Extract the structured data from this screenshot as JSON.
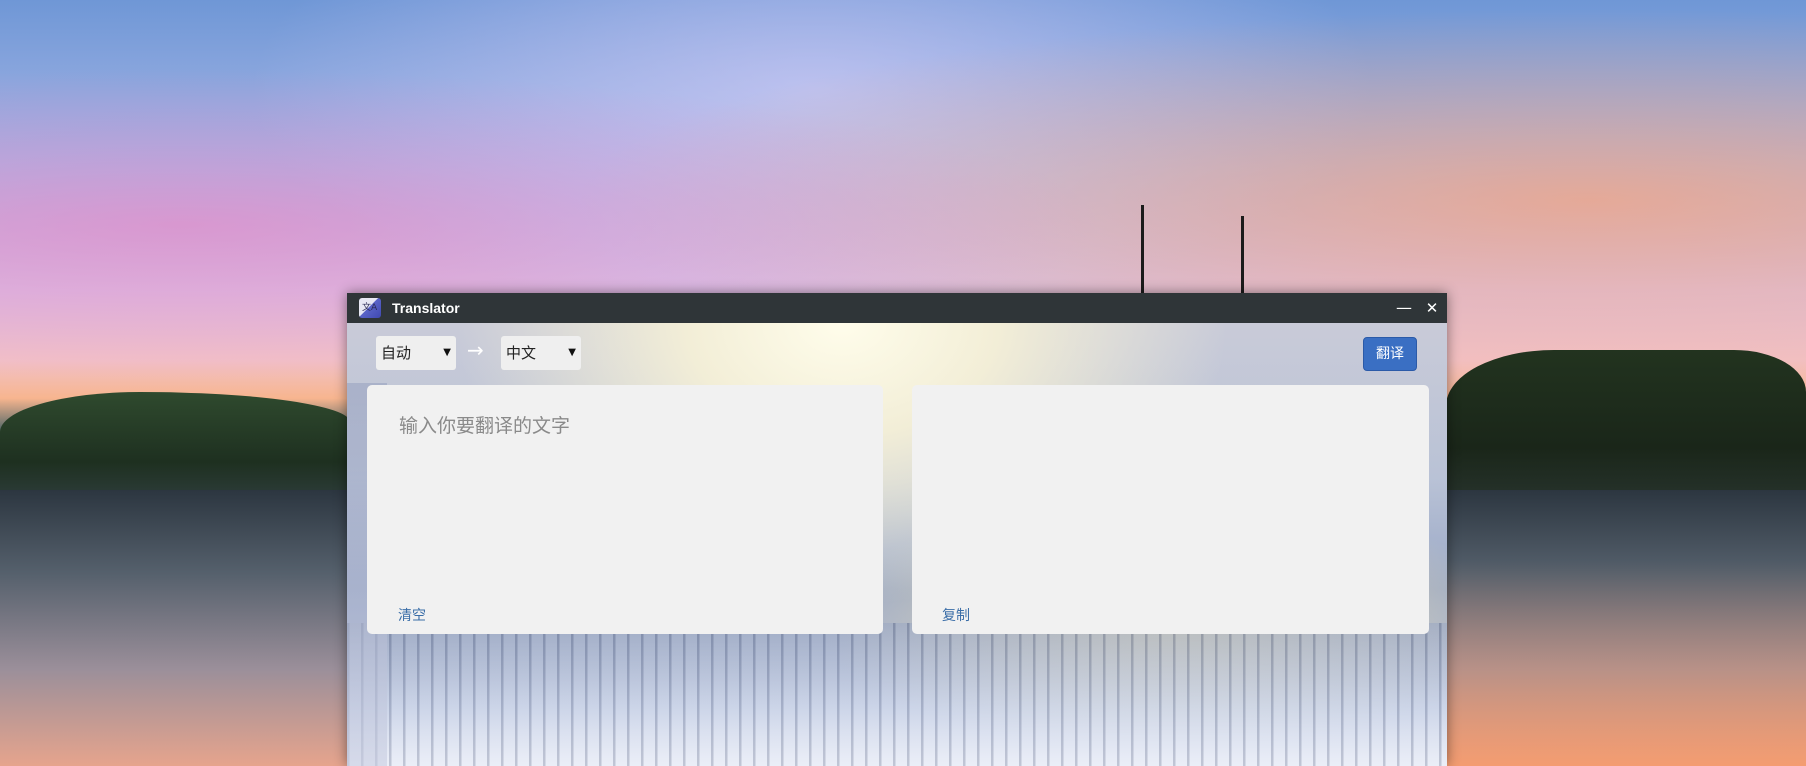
{
  "window": {
    "title": "Translator",
    "app_icon": "translator-icon"
  },
  "toolbar": {
    "source_language": "自动",
    "target_language": "中文",
    "arrow_icon": "arrow-right-icon",
    "translate_label": "翻译"
  },
  "input": {
    "placeholder": "输入你要翻译的文字",
    "clear_label": "清空"
  },
  "output": {
    "text": "",
    "copy_label": "复制"
  },
  "colors": {
    "titlebar": "#2f3538",
    "accent": "#3a6fc3",
    "link": "#3b6ea8",
    "panel": "#f1f1f1"
  }
}
